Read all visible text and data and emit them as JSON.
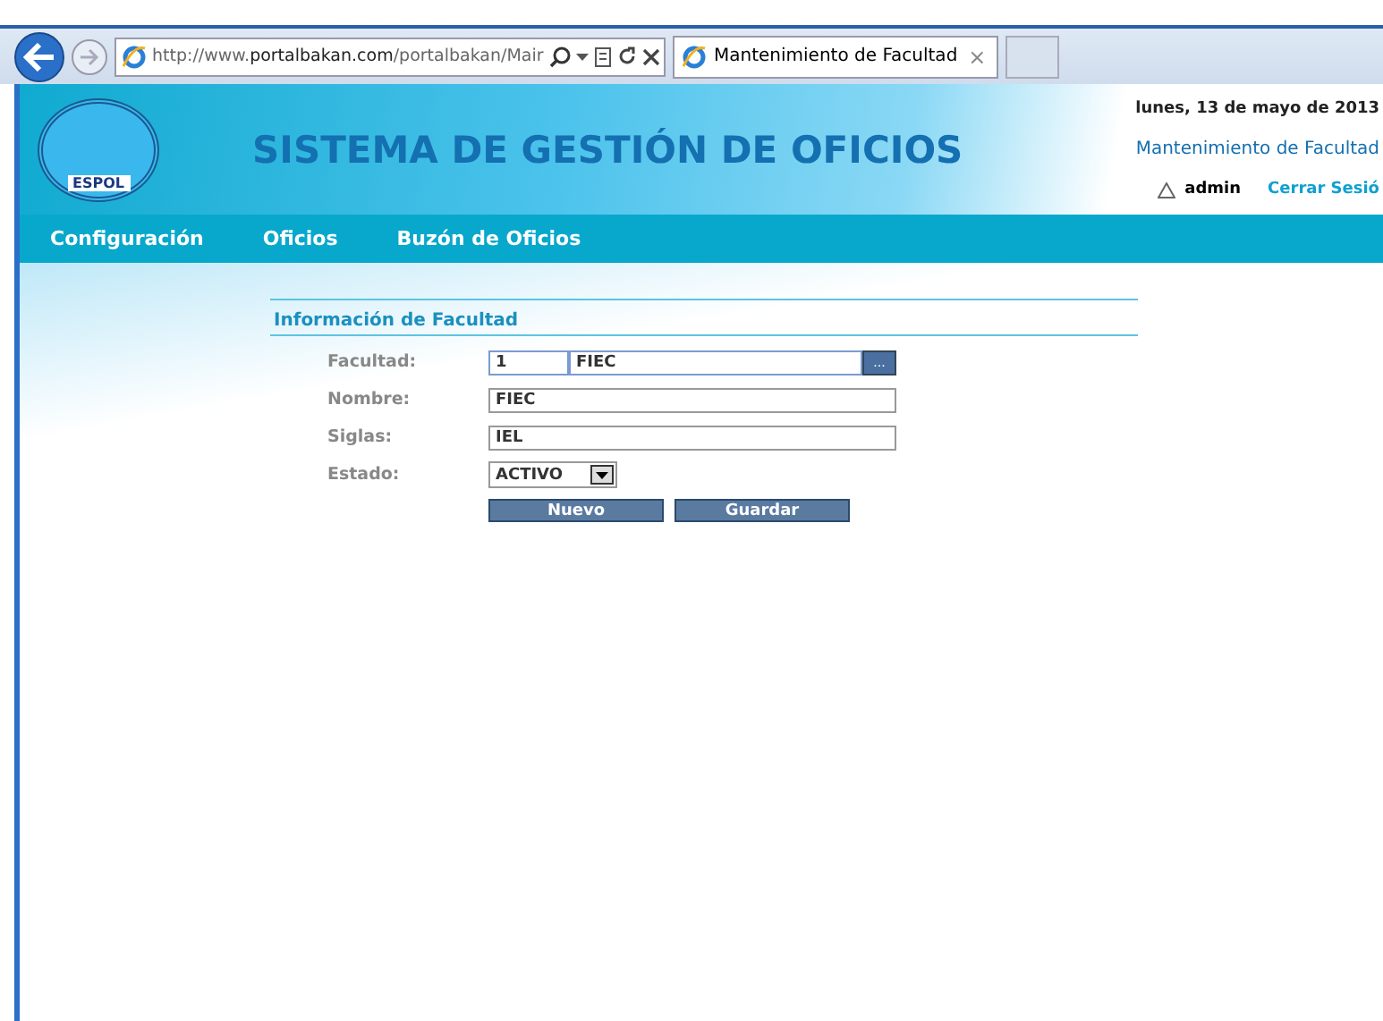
{
  "browser": {
    "address": {
      "prefix": "http://www.",
      "domain": "portalbakan.com",
      "path": "/portalbakan/Mair"
    },
    "tab": {
      "title": "Mantenimiento de Facultad",
      "close": "×"
    }
  },
  "header": {
    "logo_text": "ESPOL",
    "title": "SISTEMA DE GESTIÓN DE OFICIOS",
    "date": "lunes, 13 de mayo de 2013",
    "page": "Mantenimiento de Facultad",
    "user": "admin",
    "logout": "Cerrar Sesió"
  },
  "nav": [
    {
      "label": "Configuración"
    },
    {
      "label": "Oficios"
    },
    {
      "label": "Buzón de Oficios"
    }
  ],
  "form": {
    "title": "Información de Facultad",
    "fields": [
      {
        "kind": "lookup",
        "label": "Facultad:",
        "code": "1",
        "value": "FIEC",
        "button": "..."
      },
      {
        "kind": "text",
        "label": "Nombre:",
        "value": "FIEC"
      },
      {
        "kind": "text",
        "label": "Siglas:",
        "value": "IEL"
      },
      {
        "kind": "select",
        "label": "Estado:",
        "value": "ACTIVO"
      }
    ],
    "buttons": [
      "Nuevo",
      "Guardar"
    ]
  }
}
